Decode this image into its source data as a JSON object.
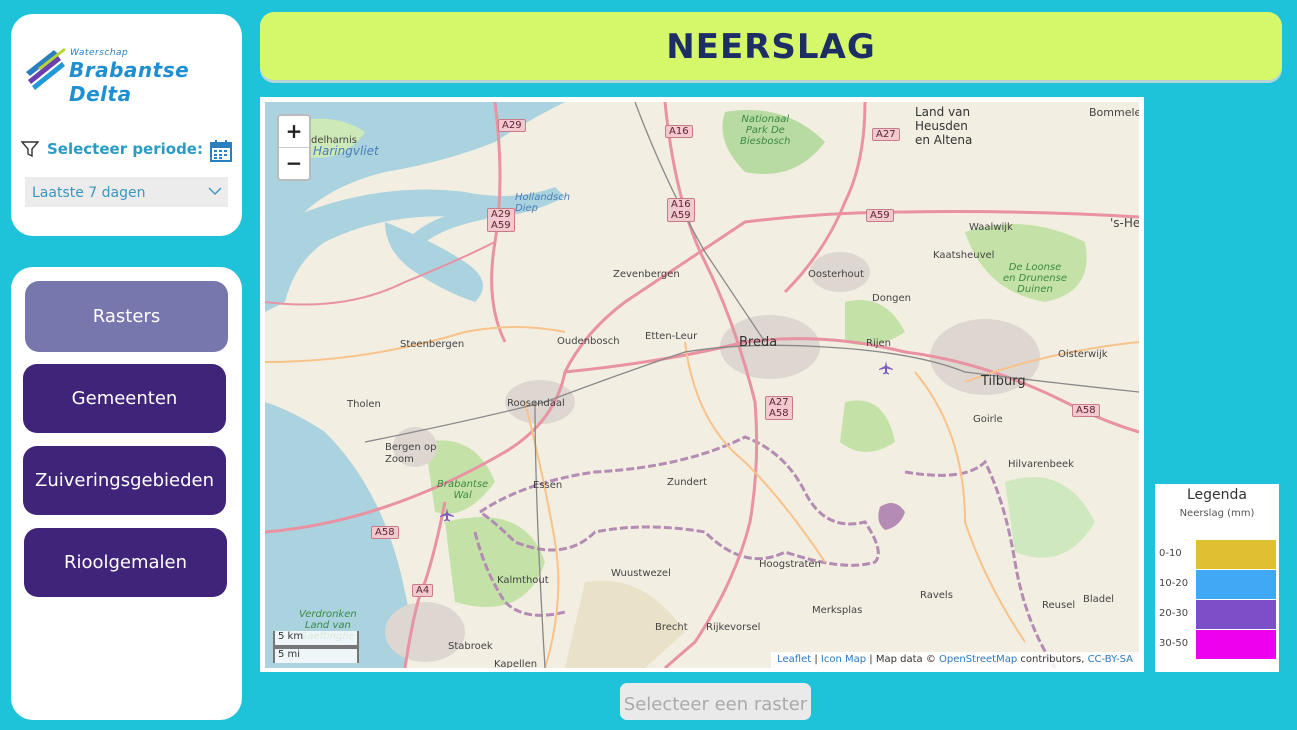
{
  "logo": {
    "small": "Waterschap",
    "big": "Brabantse Delta"
  },
  "filter": {
    "label": "Selecteer periode:",
    "selected": "Laatste 7 dagen"
  },
  "nav": [
    {
      "label": "Rasters"
    },
    {
      "label": "Gemeenten"
    },
    {
      "label": "Zuiveringsgebieden"
    },
    {
      "label": "Rioolgemalen"
    }
  ],
  "title": "NEERSLAG",
  "map": {
    "zoom_in": "+",
    "zoom_out": "−",
    "scale_km": "5 km",
    "scale_mi": "5 mi",
    "attribution": {
      "leaflet": "Leaflet",
      "sep1": " | ",
      "iconmap": "Icon Map",
      "mapdata": " | Map data © ",
      "osm": "OpenStreetMap",
      "contrib": " contributors, ",
      "license": "CC-BY-SA"
    },
    "places": {
      "middelharnis": "delharnis",
      "zevenbergen": "Zevenbergen",
      "oosterhout": "Oosterhout",
      "kaatsheuvel": "Kaatsheuvel",
      "waalwijk": "Waalwijk",
      "dongen": "Dongen",
      "steenbergen": "Steenbergen",
      "oudenbosch": "Oudenbosch",
      "ettenleur": "Etten-Leur",
      "rijen": "Rijen",
      "oisterwijk": "Oisterwijk",
      "tholen": "Tholen",
      "roosendaal": "Roosendaal",
      "goirle": "Goirle",
      "bergen": "Bergen op\nZoom",
      "essen": "Essen",
      "zundert": "Zundert",
      "hilvarenbeek": "Hilvarenbeek",
      "hoogstraten": "Hoogstraten",
      "wuustwezel": "Wuustwezel",
      "kalmthout": "Kalmthout",
      "ravels": "Ravels",
      "reusel": "Reusel",
      "bladel": "Bladel",
      "merksplas": "Merksplas",
      "brecht": "Brecht",
      "rijkevorsel": "Rijkevorsel",
      "stabroek": "Stabroek",
      "kapellen": "Kapellen",
      "hertogenbosch": "'s-He",
      "bommelerwaard": "Bommelerwaa",
      "landvanheusden": "Land van\nHeusden\nen Altena"
    },
    "cities": {
      "breda": "Breda",
      "tilburg": "Tilburg"
    },
    "green_labels": {
      "biesbosch": "Nationaal\nPark De\nBiesbosch",
      "loonse": "De Loonse\nen Drunense\nDuinen",
      "brabantsewal": "Brabantse\nWal",
      "verdronken": "Verdronken\nLand van\nSaeftinghe"
    },
    "water_labels": {
      "haringvliet": "Haringvliet",
      "hollandsdiep": "Hollandsch\nDiep"
    },
    "shields": {
      "a29": "A29",
      "a16": "A16",
      "a27": "A27",
      "a29a59": "A29\nA59",
      "a16a59": "A16\nA59",
      "a59": "A59",
      "a27a58": "A27\nA58",
      "a58e": "A58",
      "a58w": "A58",
      "a4": "A4"
    }
  },
  "legend": {
    "title": "Legenda",
    "subtitle": "Neerslag (mm)",
    "items": [
      {
        "label": "0-10",
        "color": "#e0c030"
      },
      {
        "label": "10-20",
        "color": "#3fa9f5"
      },
      {
        "label": "20-30",
        "color": "#7c4fc9"
      },
      {
        "label": "30-50",
        "color": "#ee00ee"
      }
    ]
  },
  "raster_button": "Selecteer een raster",
  "colors": {
    "background": "#1ec3d9",
    "title_bar": "#d5f86b",
    "title_text": "#1c2e63",
    "nav_active": "#7776ad",
    "nav_default": "#40247a",
    "accent": "#2a9cc4"
  }
}
